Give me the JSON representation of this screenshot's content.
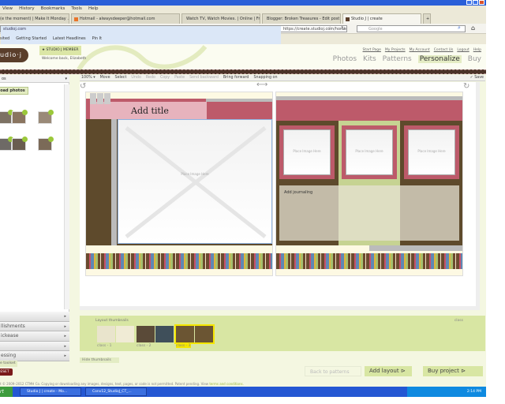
{
  "browser": {
    "menu": [
      "View",
      "History",
      "Bookmarks",
      "Tools",
      "Help"
    ],
    "tabs": [
      "(e the moment) | Make It Monday ...",
      "Hotmail - alwaysdeeper@hotmail.com",
      "Watch TV, Watch Movies. | Online | Free...",
      "Blogger: Broken Treasures - Edit post",
      "Studio J | create"
    ],
    "url_site": "studioj.com",
    "url": "https://create.studioj.com/home",
    "search_placeholder": "Google",
    "bookmarks": [
      "sited",
      "Getting Started",
      "Latest Headlines",
      "Pin It"
    ]
  },
  "site": {
    "logo": "udio·j",
    "member": "★ STUDIO J MEMBER",
    "welcome": "Welcome back, Elizabeth",
    "toplinks": [
      "Start Page",
      "My Projects",
      "My Account",
      "Contact Us",
      "Logout",
      "Help"
    ],
    "nav": [
      "Photos",
      "Kits",
      "Patterns",
      "Personalize",
      "Buy"
    ],
    "nav_active": "Personalize"
  },
  "left": {
    "select": "os",
    "upload": "oad photos",
    "accordion": [
      "",
      "llishments",
      "ickease",
      "",
      "essing"
    ],
    "toolset": "e toolset",
    "reset": "ESET"
  },
  "toolbar": {
    "zoom": "100% ▾",
    "items": [
      "Move",
      "Select",
      "Undo",
      "Redo",
      "Copy",
      "Paste",
      "Send backward",
      "Bring forward",
      "Snapping on"
    ],
    "save": "✓ Save"
  },
  "canvas": {
    "title": "Add title",
    "placeholder": "Place Image Here",
    "journaling": "Add journaling"
  },
  "thumbs": {
    "label": "Layout thumbnails",
    "class_label": "class",
    "captions": [
      "class - 1",
      "class - 2",
      "class - 3"
    ],
    "selected": 2,
    "hide": "Hide thumbnails"
  },
  "actions": {
    "back": "Back to patterns",
    "add": "Add layout",
    "buy": "Buy project"
  },
  "footer": {
    "text": "t © 2009–2012 CTMH Co. Copying or downloading any images, designs, text, pages, or code is not permitted. Patent pending. View ",
    "link": "terms and conditions."
  },
  "taskbar": {
    "start": "rt",
    "tasks": [
      "Studio J | create - Mo...",
      "Conv12_StudioJ_CT_..."
    ],
    "clock": "2:14 PM"
  }
}
